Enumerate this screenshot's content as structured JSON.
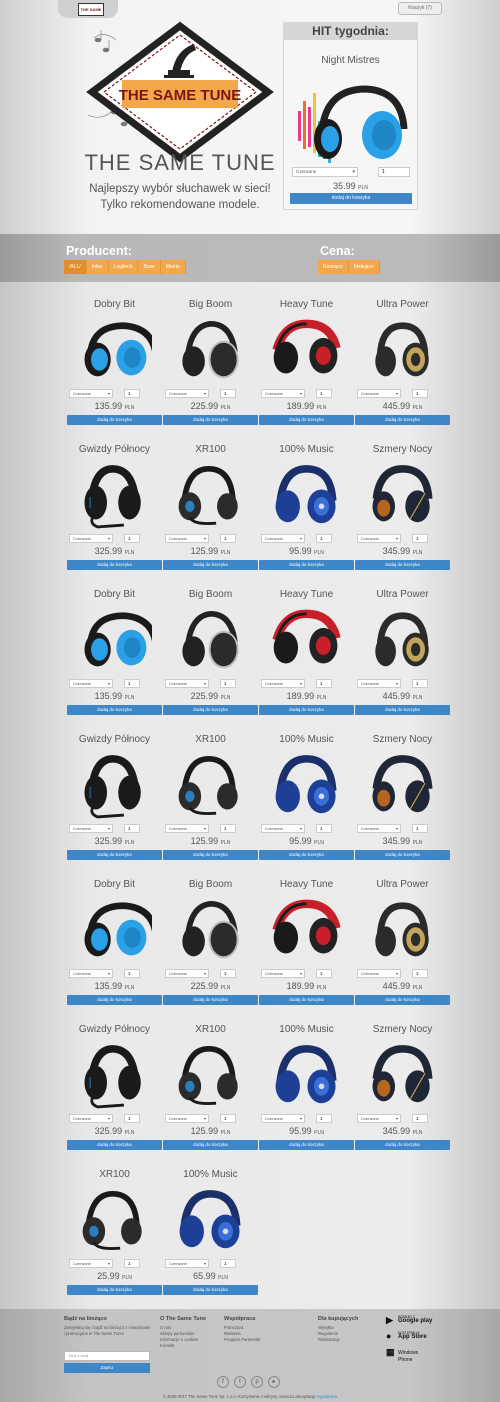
{
  "header": {
    "cart_label": "Koszyk (7)",
    "logo_text": "THE SAME TUNE",
    "brand": "THE SAME TUNE",
    "tagline_1": "Najlepszy wybór słuchawek w sieci!",
    "tagline_2": "Tylko rekomendowane modele."
  },
  "hit": {
    "title": "HIT tygodnia:",
    "name": "Night Mistres",
    "color_option": "Czerwone",
    "qty": "1",
    "price": "35.99",
    "currency": "PLN",
    "button": "dodaj do koszyka"
  },
  "filters": {
    "producer_label": "Producent:",
    "producers": [
      "/ALL/",
      "Intex",
      "Logitech",
      "Bose",
      "Manta"
    ],
    "price_label": "Cena:",
    "sorts": [
      "Rosnąco",
      "Malejąco"
    ]
  },
  "product_labels": {
    "color_option": "Czerwone",
    "qty": "1",
    "currency": "PLN",
    "button": "dodaj do koszyka"
  },
  "products": [
    {
      "name": "Dobry Bit",
      "price": "135.99",
      "icon": "blue-headphones"
    },
    {
      "name": "Big Boom",
      "price": "225.99",
      "icon": "black-silver-headphones"
    },
    {
      "name": "Heavy Tune",
      "price": "189.99",
      "icon": "red-headphones"
    },
    {
      "name": "Ultra Power",
      "price": "445.99",
      "icon": "gold-headphones"
    },
    {
      "name": "Gwizdy Północy",
      "price": "325.99",
      "icon": "headset-mic"
    },
    {
      "name": "XR100",
      "price": "125.99",
      "icon": "black-headset"
    },
    {
      "name": "100% Music",
      "price": "95.99",
      "icon": "navy-headphones"
    },
    {
      "name": "Szmery Nocy",
      "price": "345.99",
      "icon": "dark-headphones"
    },
    {
      "name": "Dobry Bit",
      "price": "135.99",
      "icon": "blue-headphones"
    },
    {
      "name": "Big Boom",
      "price": "225.99",
      "icon": "black-silver-headphones"
    },
    {
      "name": "Heavy Tune",
      "price": "189.99",
      "icon": "red-headphones"
    },
    {
      "name": "Ultra Power",
      "price": "445.99",
      "icon": "gold-headphones"
    },
    {
      "name": "Gwizdy Północy",
      "price": "325.99",
      "icon": "headset-mic"
    },
    {
      "name": "XR100",
      "price": "125.99",
      "icon": "black-headset"
    },
    {
      "name": "100% Music",
      "price": "95.99",
      "icon": "navy-headphones"
    },
    {
      "name": "Szmery Nocy",
      "price": "345.99",
      "icon": "dark-headphones"
    },
    {
      "name": "Dobry Bit",
      "price": "135.99",
      "icon": "blue-headphones"
    },
    {
      "name": "Big Boom",
      "price": "225.99",
      "icon": "black-silver-headphones"
    },
    {
      "name": "Heavy Tune",
      "price": "189.99",
      "icon": "red-headphones"
    },
    {
      "name": "Ultra Power",
      "price": "445.99",
      "icon": "gold-headphones"
    },
    {
      "name": "Gwizdy Północy",
      "price": "325.99",
      "icon": "headset-mic"
    },
    {
      "name": "XR100",
      "price": "125.99",
      "icon": "black-headset"
    },
    {
      "name": "100% Music",
      "price": "95.99",
      "icon": "navy-headphones"
    },
    {
      "name": "Szmery Nocy",
      "price": "345.99",
      "icon": "dark-headphones"
    },
    {
      "name": "XR100",
      "price": "25.99",
      "icon": "black-headset"
    },
    {
      "name": "100% Music",
      "price": "65.99",
      "icon": "navy-headphones"
    }
  ],
  "footer": {
    "news_title": "Bądź na bieżąco",
    "news_text": "Zarejestruj się i bądź na bieżąco z nowościami i promocjami w The Same Tune!",
    "email_placeholder": "Twój e-mail",
    "subscribe": "Zapisz",
    "about_title": "O The Same Tune",
    "about_links": [
      "O nas",
      "Sklepy partnerskie",
      "Informacje o cookies",
      "Kontakt"
    ],
    "coop_title": "Współpraca",
    "coop_links": [
      "Franczyza",
      "Reklama",
      "Program Partnerski"
    ],
    "buyers_title": "Dla kupujących",
    "buyers_links": [
      "Wysyłka",
      "Regulamin",
      "Reklamacje"
    ],
    "store_badges": [
      {
        "top": "POBIERZ Z",
        "name": "Google play",
        "icon": "google-play-icon"
      },
      {
        "top": "DOSTĘPNE W",
        "name": "App Store",
        "icon": "apple-icon"
      },
      {
        "top": "",
        "name": "Windows Phone",
        "icon": "windows-icon"
      }
    ],
    "socials": [
      "facebook-icon",
      "twitter-icon",
      "pinterest-icon",
      "youtube-icon"
    ],
    "copyright": "© 2009-2017 The Same Tune Sp. z o.o. Korzystanie z witryny oznacza akceptację ",
    "copyright_link": "regulaminu"
  }
}
